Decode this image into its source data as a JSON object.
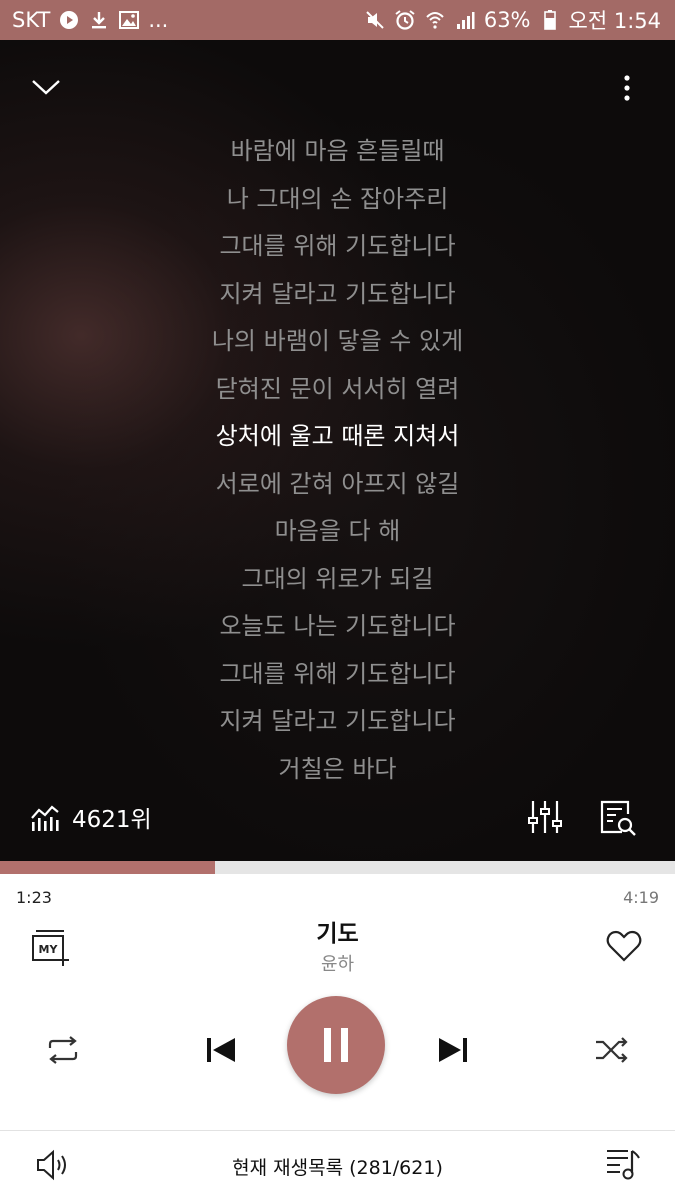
{
  "status_bar": {
    "carrier": "SKT",
    "battery": "63%",
    "time": "오전 1:54",
    "icons": [
      "play-circle-icon",
      "download-icon",
      "image-icon",
      "more-dots-icon",
      "mute-icon",
      "alarm-icon",
      "wifi-icon",
      "signal-icon",
      "battery-icon"
    ],
    "more": "..."
  },
  "lyrics": {
    "lines": [
      "바람에 마음 흔들릴때",
      "나 그대의 손 잡아주리",
      "그대를 위해 기도합니다",
      "지켜 달라고 기도합니다",
      "나의 바램이 닿을 수 있게",
      "닫혀진 문이 서서히 열려",
      "상처에 울고 때론 지쳐서",
      "서로에 갇혀 아프지 않길",
      "마음을 다 해",
      "그대의 위로가 되길",
      "오늘도 나는 기도합니다",
      "그대를 위해 기도합니다",
      "지켜 달라고 기도합니다",
      "거칠은 바다"
    ],
    "current_index": 6
  },
  "chart": {
    "rank": "4621위"
  },
  "player": {
    "progress_fraction": 0.318,
    "time_current": "1:23",
    "time_total": "4:19",
    "title": "기도",
    "artist": "윤하",
    "my_label": "MY",
    "accent_color": "#b2706c"
  },
  "bottom_bar": {
    "playlist_label": "현재 재생목록 (281/621)"
  }
}
